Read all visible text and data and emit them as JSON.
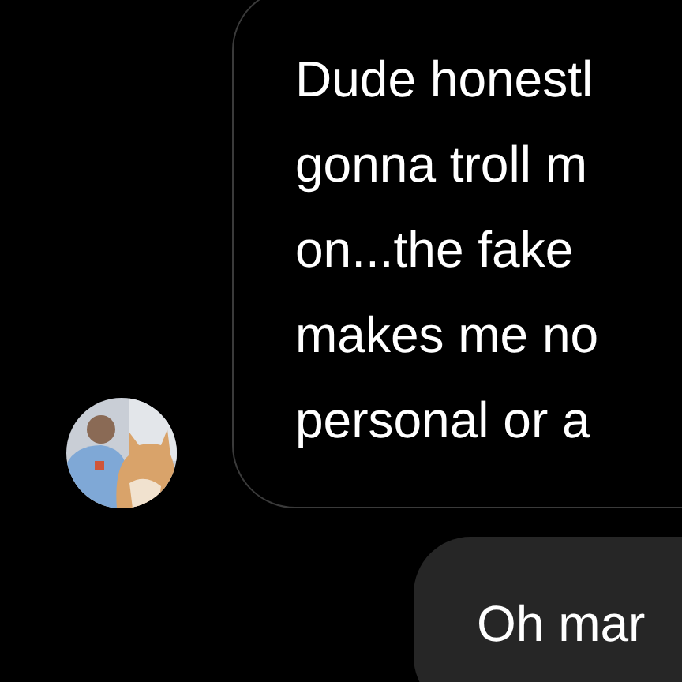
{
  "messages": [
    {
      "kind": "received",
      "lines": [
        "Dude honestl",
        "gonna troll m",
        "on...the fake",
        "makes me no",
        "personal or a"
      ]
    },
    {
      "kind": "sent",
      "lines": [
        "Oh mar"
      ]
    }
  ]
}
